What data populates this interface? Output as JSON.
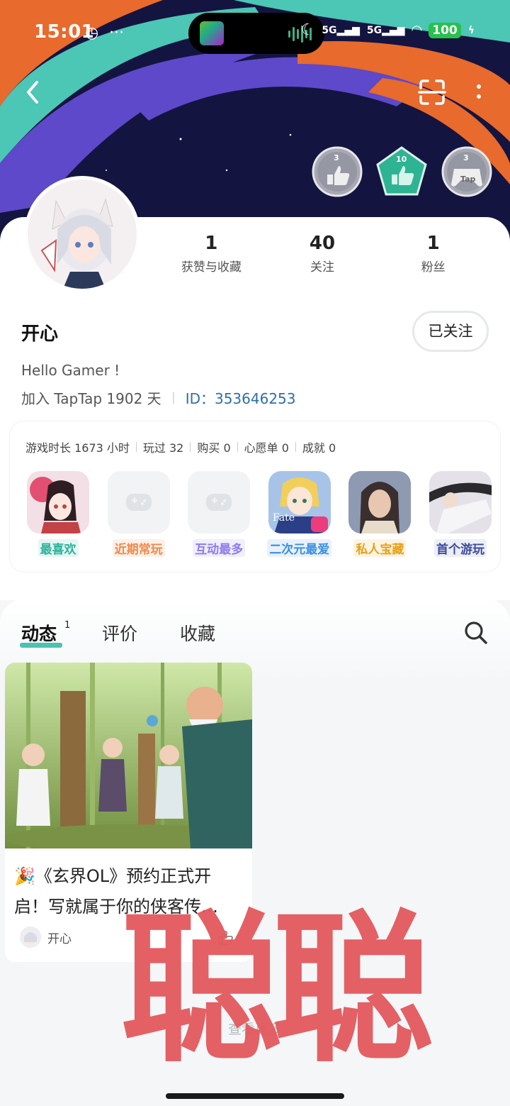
{
  "status_bar": {
    "time": "15:01",
    "extra": "···",
    "network1": "5G",
    "network2": "5G",
    "battery": "100"
  },
  "header": {
    "back_icon": "chevron-left-icon",
    "scan_icon": "scan-icon",
    "more_icon": "more-vertical-icon",
    "badges": [
      {
        "level": "3",
        "caption": "thumb-up-badge"
      },
      {
        "level": "10",
        "caption": "thumb-up-badge"
      },
      {
        "level": "3",
        "caption": "tap-badge",
        "text": "Tap"
      }
    ]
  },
  "profile": {
    "name": "开心",
    "follow_label": "已关注",
    "bio": "Hello Gamer !",
    "join_text": "加入 TapTap 1902 天",
    "id_text": "ID：353646253",
    "stats": [
      {
        "value": "1",
        "label": "获赞与收藏"
      },
      {
        "value": "40",
        "label": "关注"
      },
      {
        "value": "1",
        "label": "粉丝"
      }
    ]
  },
  "games": {
    "summary": [
      "游戏时长 1673 小时",
      "玩过 32",
      "购买 0",
      "心愿单 0",
      "成就 0"
    ],
    "items": [
      {
        "label": "最喜欢",
        "color": "#2fb39b",
        "bg": "#e6f6f2"
      },
      {
        "label": "近期常玩",
        "color": "#f08a4b",
        "bg": "#fdf0e7"
      },
      {
        "label": "互动最多",
        "color": "#8d7cf0",
        "bg": "#f1eefd"
      },
      {
        "label": "二次元最爱",
        "color": "#3d8fe0",
        "bg": "#e8f1fb"
      },
      {
        "label": "私人宝藏",
        "color": "#e6a11c",
        "bg": "#fcf4e2"
      },
      {
        "label": "首个游玩",
        "color": "#3b4a9c",
        "bg": "#eceef8"
      }
    ]
  },
  "tabs": {
    "items": [
      "动态",
      "评价",
      "收藏"
    ],
    "active_count": "1"
  },
  "post": {
    "title": "🎉《玄界OL》预约正式开启！写就属于你的侠客传…",
    "author": "开心"
  },
  "footer": {
    "load_more": "查看更多"
  },
  "watermark": "聪聪"
}
